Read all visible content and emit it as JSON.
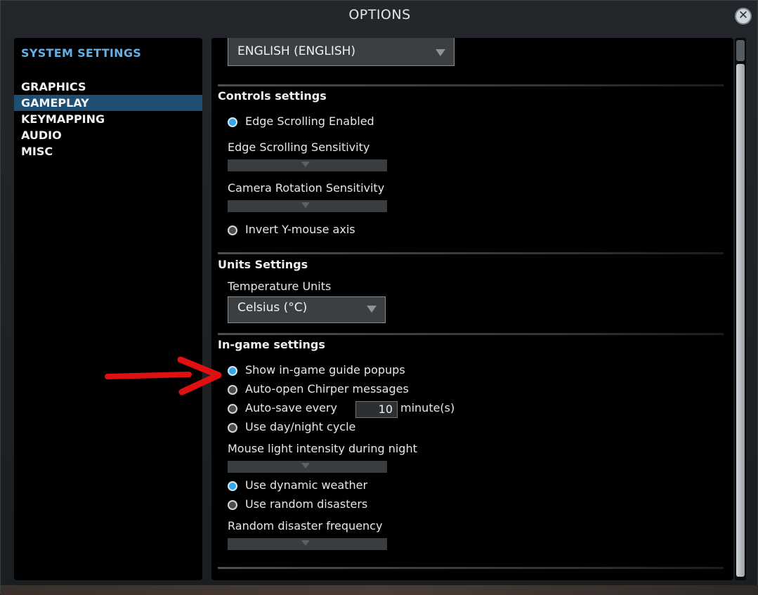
{
  "window": {
    "title": "OPTIONS",
    "close_icon": "close-icon",
    "close_glyph": "✕"
  },
  "sidebar": {
    "heading": "SYSTEM SETTINGS",
    "items": [
      {
        "label": "GRAPHICS",
        "active": false
      },
      {
        "label": "GAMEPLAY",
        "active": true
      },
      {
        "label": "KEYMAPPING",
        "active": false
      },
      {
        "label": "AUDIO",
        "active": false
      },
      {
        "label": "MISC",
        "active": false
      }
    ]
  },
  "language": {
    "selected": "ENGLISH (ENGLISH)"
  },
  "controls": {
    "title": "Controls settings",
    "edge_scrolling": {
      "label": "Edge Scrolling Enabled",
      "checked": true
    },
    "edge_sensitivity": {
      "label": "Edge Scrolling Sensitivity"
    },
    "camera_sensitivity": {
      "label": "Camera Rotation Sensitivity"
    },
    "invert_y": {
      "label": "Invert Y-mouse axis",
      "checked": false
    }
  },
  "units": {
    "title": "Units Settings",
    "temperature": {
      "label": "Temperature Units",
      "selected": "Celsius (°C)"
    }
  },
  "ingame": {
    "title": "In-game settings",
    "guide_popups": {
      "label": "Show in-game guide popups",
      "checked": true
    },
    "chirper": {
      "label": "Auto-open Chirper messages",
      "checked": false
    },
    "autosave": {
      "label": "Auto-save every",
      "value": "10",
      "unit": "minute(s)",
      "checked": false
    },
    "daynight": {
      "label": "Use day/night cycle",
      "checked": false
    },
    "mouse_light": {
      "label": "Mouse light intensity during night"
    },
    "dynamic_weather": {
      "label": "Use dynamic weather",
      "checked": true
    },
    "random_disasters": {
      "label": "Use random disasters",
      "checked": false
    },
    "disaster_frequency": {
      "label": "Random disaster frequency"
    }
  },
  "colors": {
    "accent": "#35a6e8",
    "annotation_arrow": "#e01010",
    "active_tab": "#1e4f73"
  }
}
